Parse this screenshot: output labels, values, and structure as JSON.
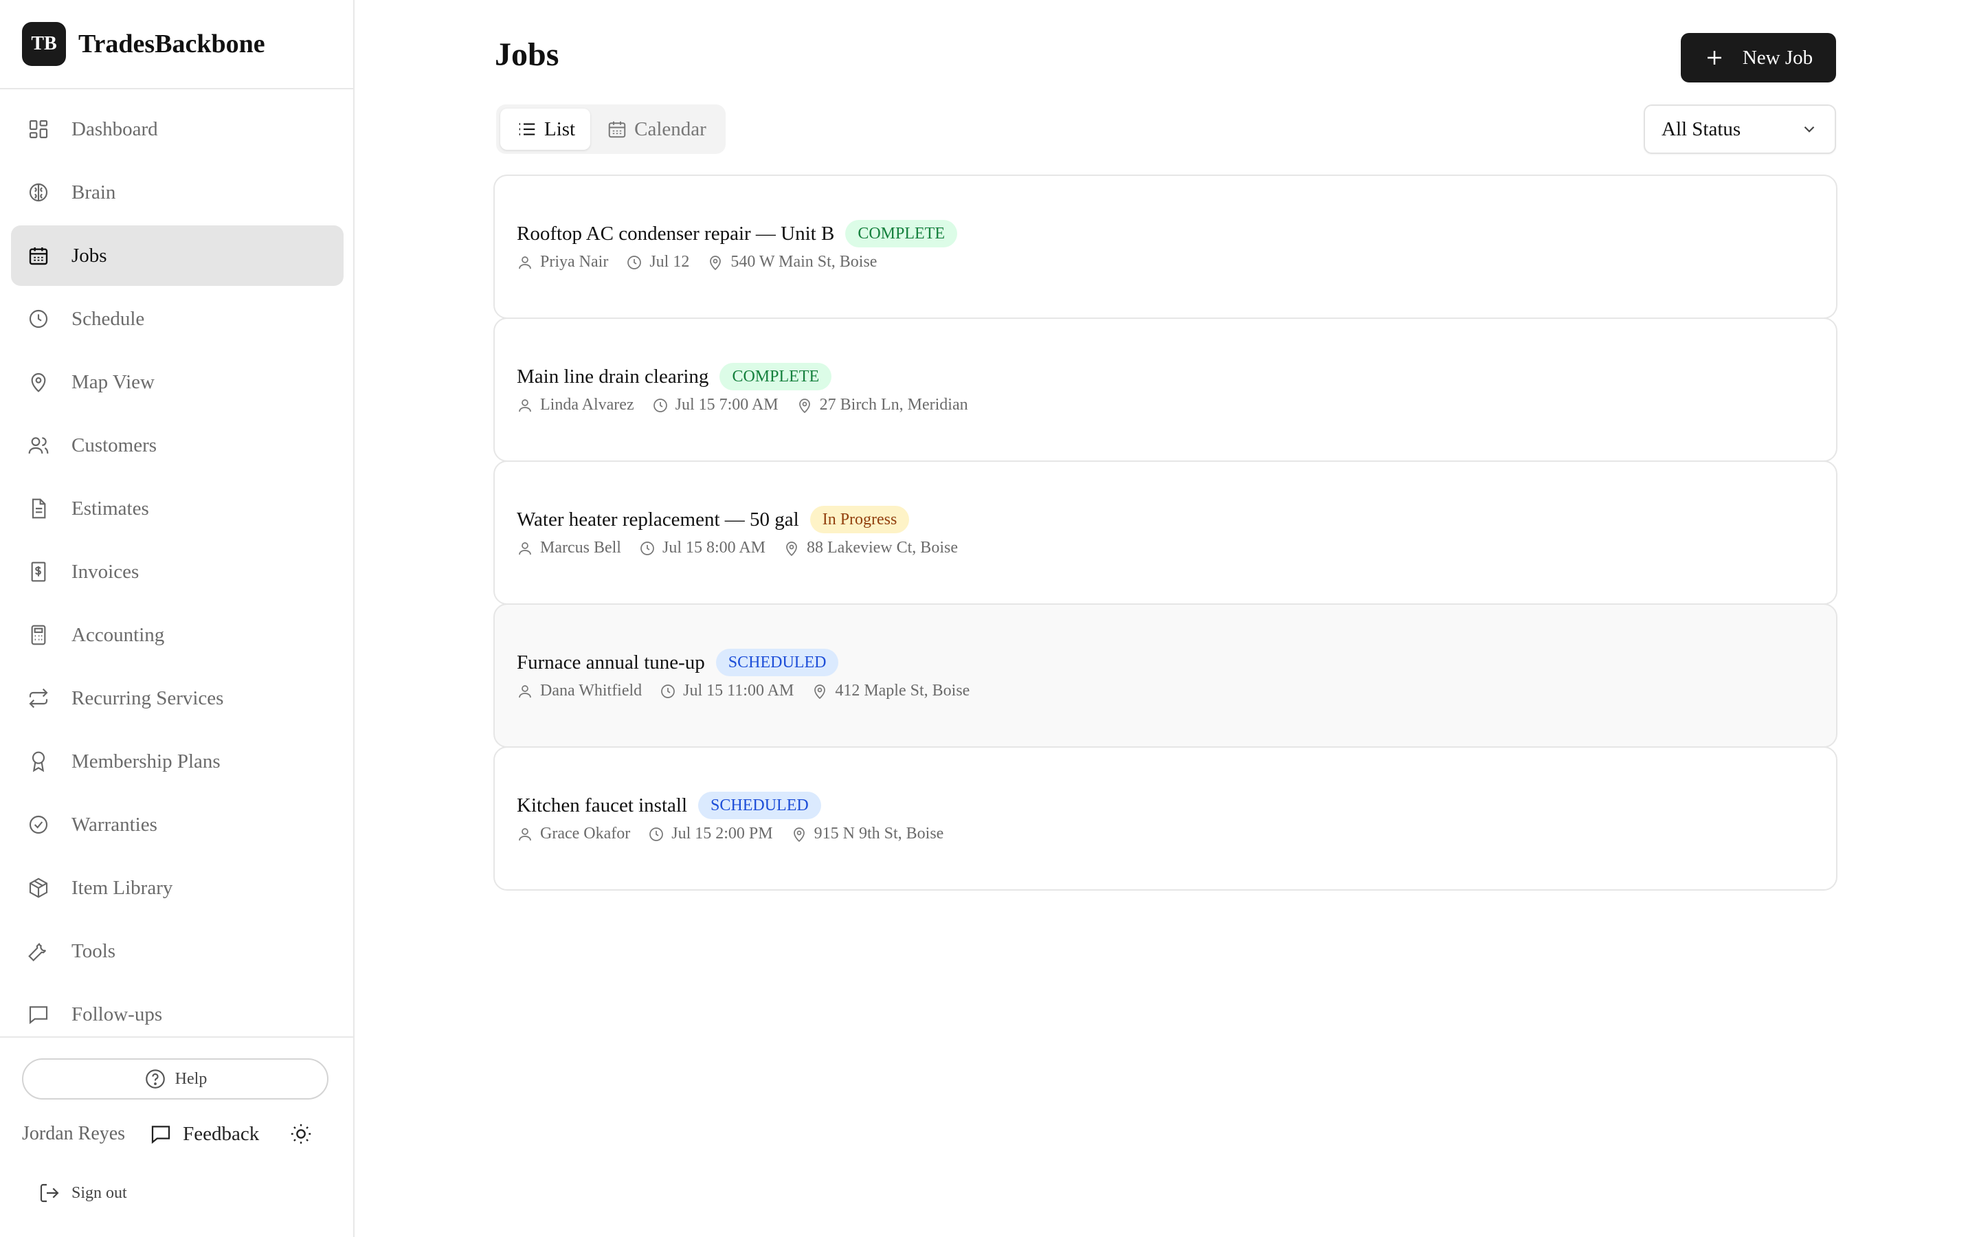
{
  "brand": {
    "logo": "TB",
    "name": "TradesBackbone"
  },
  "sidebar": {
    "items": [
      {
        "label": "Dashboard",
        "icon": "dashboard-icon"
      },
      {
        "label": "Brain",
        "icon": "brain-icon"
      },
      {
        "label": "Jobs",
        "icon": "calendar-icon",
        "active": true
      },
      {
        "label": "Schedule",
        "icon": "clock-icon"
      },
      {
        "label": "Map View",
        "icon": "map-pin-icon"
      },
      {
        "label": "Customers",
        "icon": "users-icon"
      },
      {
        "label": "Estimates",
        "icon": "file-text-icon"
      },
      {
        "label": "Invoices",
        "icon": "receipt-icon"
      },
      {
        "label": "Accounting",
        "icon": "calculator-icon"
      },
      {
        "label": "Recurring Services",
        "icon": "repeat-icon"
      },
      {
        "label": "Membership Plans",
        "icon": "award-icon"
      },
      {
        "label": "Warranties",
        "icon": "check-circle-icon"
      },
      {
        "label": "Item Library",
        "icon": "package-icon"
      },
      {
        "label": "Tools",
        "icon": "wrench-icon"
      },
      {
        "label": "Follow-ups",
        "icon": "message-square-icon"
      }
    ],
    "help_label": "Help",
    "user_name": "Jordan Reyes",
    "feedback_label": "Feedback",
    "signout_label": "Sign out"
  },
  "main": {
    "title": "Jobs",
    "new_job_label": "New Job",
    "view_toggle": {
      "list_label": "List",
      "calendar_label": "Calendar",
      "selected": "List"
    },
    "status_filter": {
      "value": "All Status"
    },
    "jobs": [
      {
        "title": "Rooftop AC condenser repair — Unit B",
        "status": "COMPLETE",
        "status_kind": "complete",
        "tech": "Priya Nair",
        "time": "Jul 12",
        "address": "540 W Main St, Boise"
      },
      {
        "title": "Main line drain clearing",
        "status": "COMPLETE",
        "status_kind": "complete",
        "tech": "Linda Alvarez",
        "time": "Jul 15 7:00 AM",
        "address": "27 Birch Ln, Meridian"
      },
      {
        "title": "Water heater replacement — 50 gal",
        "status": "In Progress",
        "status_kind": "progress",
        "tech": "Marcus Bell",
        "time": "Jul 15 8:00 AM",
        "address": "88 Lakeview Ct, Boise"
      },
      {
        "title": "Furnace annual tune-up",
        "status": "SCHEDULED",
        "status_kind": "scheduled",
        "tech": "Dana Whitfield",
        "time": "Jul 15 11:00 AM",
        "address": "412 Maple St, Boise"
      },
      {
        "title": "Kitchen faucet install",
        "status": "SCHEDULED",
        "status_kind": "scheduled",
        "tech": "Grace Okafor",
        "time": "Jul 15 2:00 PM",
        "address": "915 N 9th St, Boise"
      }
    ]
  },
  "colors": {
    "primary": "#1a1a1a",
    "active_nav_bg": "#e5e5e5",
    "complete_bg": "#dcfce7",
    "complete_fg": "#15803d",
    "progress_bg": "#fef3c7",
    "progress_fg": "#92400e",
    "scheduled_bg": "#dbeafe",
    "scheduled_fg": "#1d4ed8"
  }
}
